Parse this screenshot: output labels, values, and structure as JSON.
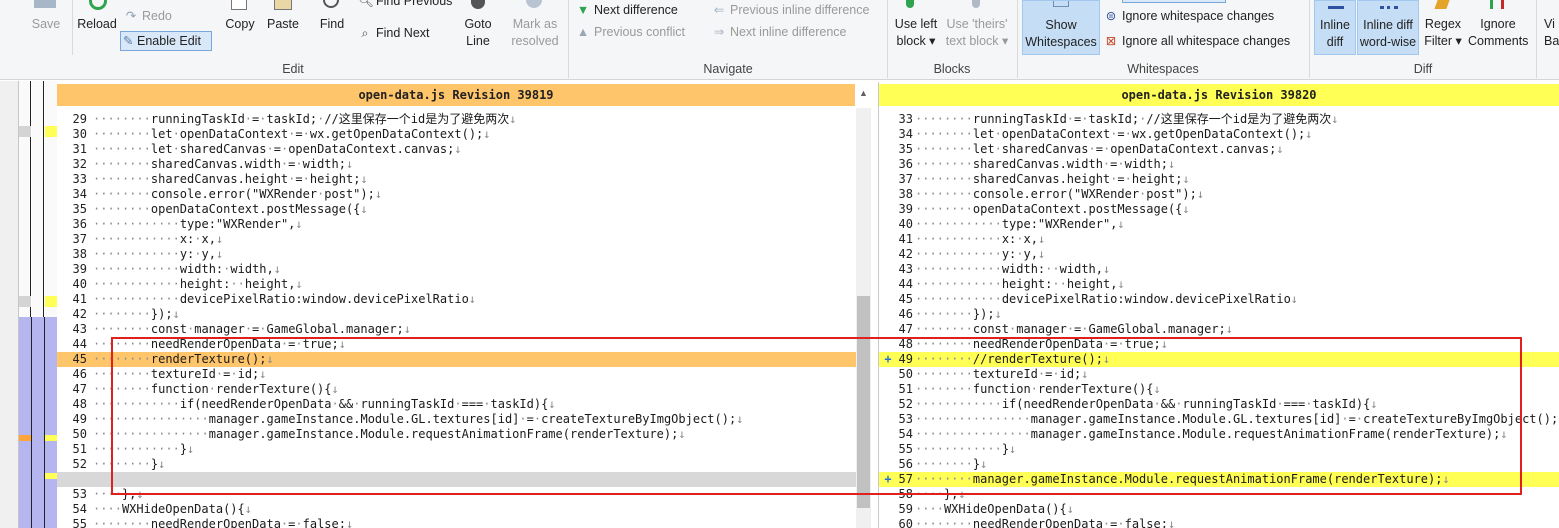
{
  "ribbon": {
    "file": {
      "save": "Save",
      "reload": "Reload",
      "redo": "Redo",
      "enable_edit": "Enable Edit",
      "copy": "Copy",
      "paste": "Paste",
      "find": "Find",
      "find_previous": "Find Previous",
      "find_next": "Find Next",
      "goto_line": "Goto\nLine",
      "mark_as_resolved": "Mark as\nresolved",
      "group": "Edit"
    },
    "navigate": {
      "next_difference": "Next difference",
      "previous_conflict": "Previous conflict",
      "previous_inline_difference": "Previous inline difference",
      "next_inline_difference": "Next inline difference",
      "group": "Navigate"
    },
    "blocks": {
      "use_left_block": "Use left\nblock ▾",
      "use_theirs_text_block": "Use 'theirs'\ntext block ▾",
      "group": "Blocks"
    },
    "whitespaces": {
      "show_whitespaces": "Show\nWhitespaces",
      "ignore_whitespace_changes": "Ignore whitespace changes",
      "ignore_all_whitespace_changes": "Ignore all whitespace changes",
      "group": "Whitespaces"
    },
    "diff": {
      "inline_diff": "Inline\ndiff",
      "inline_diff_word_wise": "Inline diff\nword-wise",
      "regex_filter": "Regex\nFilter ▾",
      "ignore_comments": "Ignore\nComments",
      "view_partial": "Vi\nBa",
      "group": "Diff"
    }
  },
  "left_pane": {
    "title": "open-data.js  Revision 39819",
    "lines": [
      {
        "n": "29",
        "t": "········runningTaskId·=·taskId;·//这里保存一个id是为了避免两次↓"
      },
      {
        "n": "30",
        "t": "········let·openDataContext·=·wx.getOpenDataContext();↓"
      },
      {
        "n": "31",
        "t": "········let·sharedCanvas·=·openDataContext.canvas;↓"
      },
      {
        "n": "32",
        "t": "········sharedCanvas.width·=·width;↓"
      },
      {
        "n": "33",
        "t": "········sharedCanvas.height·=·height;↓"
      },
      {
        "n": "34",
        "t": "········console.error(\"WXRender·post\");↓"
      },
      {
        "n": "35",
        "t": "········openDataContext.postMessage({↓"
      },
      {
        "n": "36",
        "t": "············type:\"WXRender\",↓"
      },
      {
        "n": "37",
        "t": "············x:·x,↓"
      },
      {
        "n": "38",
        "t": "············y:·y,↓"
      },
      {
        "n": "39",
        "t": "············width:·width,↓"
      },
      {
        "n": "40",
        "t": "············height:··height,↓"
      },
      {
        "n": "41",
        "t": "············devicePixelRatio:window.devicePixelRatio↓"
      },
      {
        "n": "42",
        "t": "········});↓"
      },
      {
        "n": "43",
        "t": "········const·manager·=·GameGlobal.manager;↓"
      },
      {
        "n": "44",
        "t": "········needRenderOpenData·=·true;↓"
      },
      {
        "n": "45",
        "t": "········renderTexture();↓"
      },
      {
        "n": "46",
        "t": "········textureId·=·id;↓"
      },
      {
        "n": "47",
        "t": "········function·renderTexture(){↓"
      },
      {
        "n": "48",
        "t": "············if(needRenderOpenData·&&·runningTaskId·===·taskId){↓"
      },
      {
        "n": "49",
        "t": "················manager.gameInstance.Module.GL.textures[id]·=·createTextureByImgObject();↓"
      },
      {
        "n": "50",
        "t": "················manager.gameInstance.Module.requestAnimationFrame(renderTexture);↓"
      },
      {
        "n": "51",
        "t": "············}↓"
      },
      {
        "n": "52",
        "t": "········}↓"
      },
      {
        "n": "",
        "t": ""
      },
      {
        "n": "53",
        "t": "····},↓"
      },
      {
        "n": "54",
        "t": "····WXHideOpenData(){↓"
      },
      {
        "n": "55",
        "t": "········needRenderOpenData·=·false;↓"
      }
    ]
  },
  "right_pane": {
    "title": "open-data.js  Revision 39820",
    "lines": [
      {
        "n": "33",
        "t": "········runningTaskId·=·taskId;·//这里保存一个id是为了避免两次↓"
      },
      {
        "n": "34",
        "t": "········let·openDataContext·=·wx.getOpenDataContext();↓"
      },
      {
        "n": "35",
        "t": "········let·sharedCanvas·=·openDataContext.canvas;↓"
      },
      {
        "n": "36",
        "t": "········sharedCanvas.width·=·width;↓"
      },
      {
        "n": "37",
        "t": "········sharedCanvas.height·=·height;↓"
      },
      {
        "n": "38",
        "t": "········console.error(\"WXRender·post\");↓"
      },
      {
        "n": "39",
        "t": "········openDataContext.postMessage({↓"
      },
      {
        "n": "40",
        "t": "············type:\"WXRender\",↓"
      },
      {
        "n": "41",
        "t": "············x:·x,↓"
      },
      {
        "n": "42",
        "t": "············y:·y,↓"
      },
      {
        "n": "43",
        "t": "············width:··width,↓"
      },
      {
        "n": "44",
        "t": "············height:··height,↓"
      },
      {
        "n": "45",
        "t": "············devicePixelRatio:window.devicePixelRatio↓"
      },
      {
        "n": "46",
        "t": "········});↓"
      },
      {
        "n": "47",
        "t": "········const·manager·=·GameGlobal.manager;↓"
      },
      {
        "n": "48",
        "t": "········needRenderOpenData·=·true;↓"
      },
      {
        "n": "49",
        "t": "········//renderTexture();↓"
      },
      {
        "n": "50",
        "t": "········textureId·=·id;↓"
      },
      {
        "n": "51",
        "t": "········function·renderTexture(){↓"
      },
      {
        "n": "52",
        "t": "············if(needRenderOpenData·&&·runningTaskId·===·taskId){↓"
      },
      {
        "n": "53",
        "t": "················manager.gameInstance.Module.GL.textures[id]·=·createTextureByImgObject();↓"
      },
      {
        "n": "54",
        "t": "················manager.gameInstance.Module.requestAnimationFrame(renderTexture);↓"
      },
      {
        "n": "55",
        "t": "············}↓"
      },
      {
        "n": "56",
        "t": "········}↓"
      },
      {
        "n": "57",
        "t": "········manager.gameInstance.Module.requestAnimationFrame(renderTexture);↓"
      },
      {
        "n": "58",
        "t": "····},↓"
      },
      {
        "n": "59",
        "t": "····WXHideOpenData(){↓"
      },
      {
        "n": "60",
        "t": "········needRenderOpenData·=·false;↓"
      }
    ]
  },
  "colors": {
    "left_header": "#ffc56b",
    "right_header": "#ffff55",
    "removed_line": "#ffc56b",
    "added_line": "#ffff55",
    "annotation_box": "#e0201c",
    "active_button": "#c5def5"
  },
  "icons": [
    "save-icon",
    "reload-icon",
    "redo-icon",
    "enable-edit-icon",
    "copy-icon",
    "paste-icon",
    "find-icon",
    "find-previous-icon",
    "find-next-icon",
    "goto-line-icon",
    "mark-resolved-icon",
    "next-difference-icon",
    "previous-conflict-icon",
    "previous-inline-difference-icon",
    "next-inline-difference-icon",
    "use-left-block-icon",
    "use-theirs-block-icon",
    "show-whitespaces-icon",
    "ignore-whitespace-changes-icon",
    "ignore-all-whitespace-changes-icon",
    "inline-diff-icon",
    "inline-diff-word-wise-icon",
    "regex-filter-icon",
    "ignore-comments-icon"
  ]
}
